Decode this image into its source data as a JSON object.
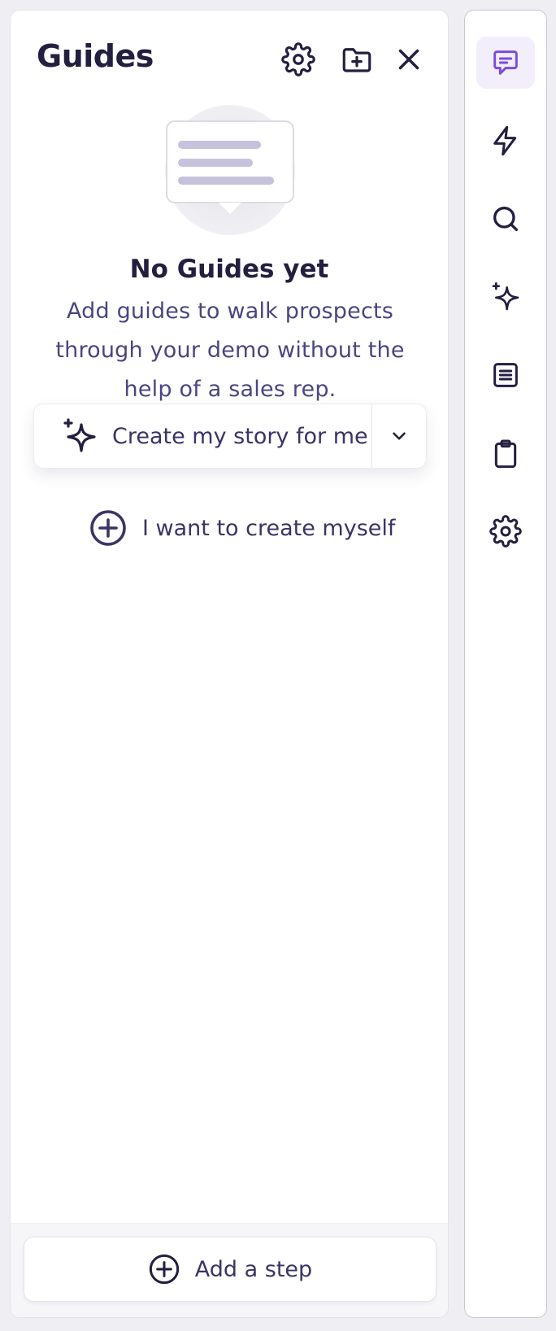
{
  "panel": {
    "title": "Guides",
    "empty_state": {
      "title": "No Guides yet",
      "description": "Add guides to walk prospects through your demo without the help of a sales rep."
    },
    "primary_action": {
      "label": "Create my story for me",
      "icon": "sparkle-icon"
    },
    "dropdown": {
      "icon": "chevron-down-icon"
    },
    "secondary_action": {
      "label": "I want to create myself",
      "icon": "plus-circle-icon"
    },
    "footer": {
      "label": "Add a step",
      "icon": "plus-circle-icon"
    },
    "header_icons": [
      "gear-icon",
      "folder-plus-icon",
      "close-icon"
    ]
  },
  "rail": {
    "items": [
      {
        "name": "guides",
        "icon": "message-square-icon",
        "active": true
      },
      {
        "name": "actions",
        "icon": "lightning-icon",
        "active": false
      },
      {
        "name": "search",
        "icon": "search-icon",
        "active": false
      },
      {
        "name": "ai",
        "icon": "sparkle-icon",
        "active": false
      },
      {
        "name": "content",
        "icon": "document-icon",
        "active": false
      },
      {
        "name": "clipboard",
        "icon": "clipboard-icon",
        "active": false
      },
      {
        "name": "settings",
        "icon": "gear-icon",
        "active": false
      }
    ]
  },
  "colors": {
    "primary_text": "#231f40",
    "secondary_text": "#4b4580",
    "accent": "#7c4ddf",
    "active_bg": "#f3eefc",
    "page_bg": "#eeeef3"
  }
}
